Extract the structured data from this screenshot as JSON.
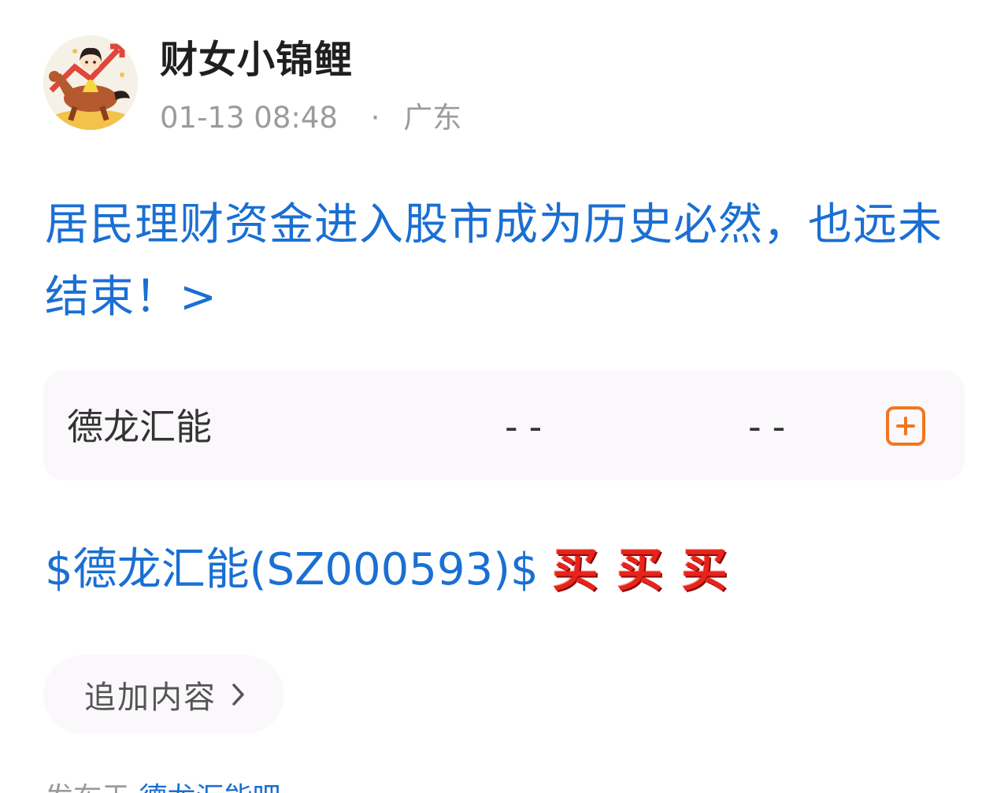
{
  "author": {
    "name": "财女小锦鲤",
    "avatar_icon": "avatar-girl-riding-horse-icon"
  },
  "meta": {
    "time": "01-13 08:48",
    "separator": "·",
    "location": "广东"
  },
  "post": {
    "title": "居民理财资金进入股市成为历史必然，也远未结束！>"
  },
  "stock_card": {
    "name": "德龙汇能",
    "price": "--",
    "change": "--",
    "add_icon": "plus-square-icon",
    "accent_color": "#f2761f"
  },
  "stock_line": {
    "link": "$德龙汇能(SZ000593)$",
    "emojis": [
      "买",
      "买",
      "买"
    ],
    "emoji_color": "#e8231c"
  },
  "append": {
    "label": "追加内容",
    "icon": "chevron-right-icon"
  },
  "footer": {
    "prefix": "发布于",
    "topic": "德龙汇能吧"
  },
  "colors": {
    "link": "#1a6fd3",
    "muted": "#9b9b9b",
    "card_bg": "#fbf8fb"
  }
}
